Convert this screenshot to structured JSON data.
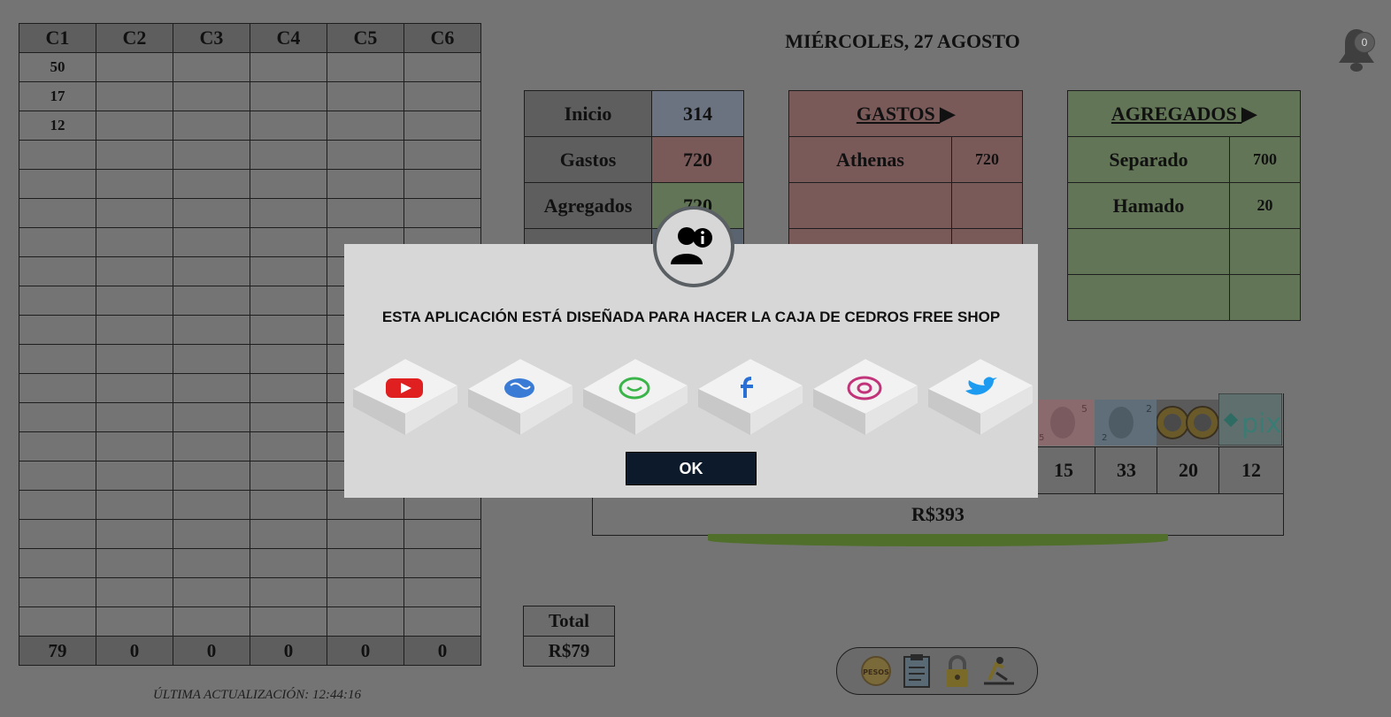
{
  "grid": {
    "headers": [
      "C1",
      "C2",
      "C3",
      "C4",
      "C5",
      "C6"
    ],
    "rows": [
      [
        "50",
        "",
        "",
        "",
        "",
        ""
      ],
      [
        "17",
        "",
        "",
        "",
        "",
        ""
      ],
      [
        "12",
        "",
        "",
        "",
        "",
        ""
      ],
      [
        "",
        "",
        "",
        "",
        "",
        ""
      ],
      [
        "",
        "",
        "",
        "",
        "",
        ""
      ],
      [
        "",
        "",
        "",
        "",
        "",
        ""
      ],
      [
        "",
        "",
        "",
        "",
        "",
        ""
      ],
      [
        "",
        "",
        "",
        "",
        "",
        ""
      ],
      [
        "",
        "",
        "",
        "",
        "",
        ""
      ],
      [
        "",
        "",
        "",
        "",
        "",
        ""
      ],
      [
        "",
        "",
        "",
        "",
        "",
        ""
      ],
      [
        "",
        "",
        "",
        "",
        "",
        ""
      ],
      [
        "",
        "",
        "",
        "",
        "",
        ""
      ],
      [
        "",
        "",
        "",
        "",
        "",
        ""
      ],
      [
        "",
        "",
        "",
        "",
        "",
        ""
      ],
      [
        "",
        "",
        "",
        "",
        "",
        ""
      ],
      [
        "",
        "",
        "",
        "",
        "",
        ""
      ],
      [
        "",
        "",
        "",
        "",
        "",
        ""
      ],
      [
        "",
        "",
        "",
        "",
        "",
        ""
      ],
      [
        "",
        "",
        "",
        "",
        "",
        ""
      ]
    ],
    "totals": [
      "79",
      "0",
      "0",
      "0",
      "0",
      "0"
    ]
  },
  "last_update": "ÚLTIMA ACTUALIZACIÓN: 12:44:16",
  "date": "MIÉRCOLES, 27 AGOSTO",
  "notifications": {
    "count": "0",
    "icon": "bell-icon"
  },
  "summary": {
    "rows": [
      {
        "label": "Inicio",
        "value": "314",
        "color": "#6b7280"
      },
      {
        "label": "Gastos",
        "value": "720",
        "color": "#7a5959"
      },
      {
        "label": "Agregados",
        "value": "720",
        "color": "#627556"
      }
    ]
  },
  "gastos": {
    "title": "GASTOS",
    "arrow": "▶",
    "rows": [
      {
        "name": "Athenas",
        "amount": "720"
      },
      {
        "name": "",
        "amount": ""
      },
      {
        "name": "",
        "amount": ""
      }
    ]
  },
  "agregados": {
    "title": "AGREGADOS",
    "arrow": "▶",
    "rows": [
      {
        "name": "Separado",
        "amount": "700"
      },
      {
        "name": "Hamado",
        "amount": "20"
      },
      {
        "name": "",
        "amount": ""
      },
      {
        "name": "",
        "amount": ""
      }
    ]
  },
  "money": {
    "counts": [
      "15",
      "33",
      "20",
      "12"
    ],
    "total": "R$393",
    "note_labels": [
      "5",
      "2",
      "",
      ""
    ],
    "pix_label": "pix"
  },
  "total_box": {
    "label": "Total",
    "value": "R$79"
  },
  "toolbar": {
    "pesos_label": "PESOS"
  },
  "modal": {
    "message": "ESTA APLICACIÓN ESTÁ DISEÑADA PARA HACER LA CAJA DE CEDROS FREE SHOP",
    "ok": "OK",
    "socials": [
      "youtube-icon",
      "web-icon",
      "whatsapp-icon",
      "facebook-icon",
      "instagram-icon",
      "twitter-icon"
    ]
  }
}
